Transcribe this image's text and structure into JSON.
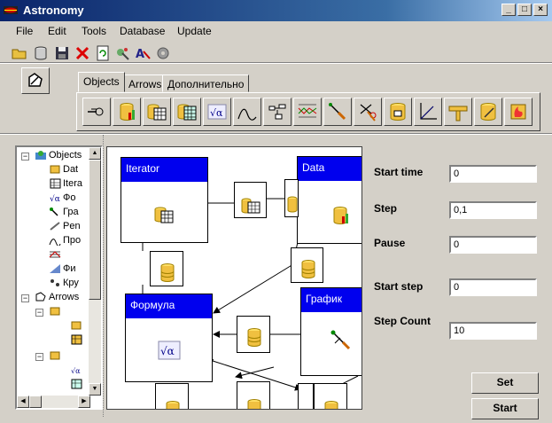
{
  "window": {
    "title": "Astronomy",
    "controls": {
      "minimize": "_",
      "maximize": "□",
      "close": "×"
    }
  },
  "menu": [
    "File",
    "Edit",
    "Tools",
    "Database",
    "Update"
  ],
  "toolbar_icons": [
    "open-folder-icon",
    "database-icon",
    "save-icon",
    "delete-icon",
    "refresh-icon",
    "tools-icon",
    "translate-icon",
    "settings-icon"
  ],
  "tabs": [
    {
      "label": "Objects",
      "active": true
    },
    {
      "label": "Arrows",
      "active": false
    },
    {
      "label": "Дополнительно",
      "active": false
    }
  ],
  "components": [
    "link",
    "data",
    "iterator",
    "table",
    "formula",
    "curve",
    "graph-tool",
    "chart-lines",
    "probe",
    "scissors",
    "data-chart",
    "axes",
    "ruler",
    "data-pencil",
    "fire"
  ],
  "tree": {
    "items": [
      {
        "label": "Objects",
        "level": 0,
        "expander": "−"
      },
      {
        "label": "Dat",
        "level": 1
      },
      {
        "label": "Itera",
        "level": 1
      },
      {
        "label": "Фо",
        "level": 1
      },
      {
        "label": "Гра",
        "level": 1
      },
      {
        "label": "Pen",
        "level": 1
      },
      {
        "label": "Про",
        "level": 1
      },
      {
        "label": "",
        "level": 1
      },
      {
        "label": "Фи",
        "level": 1
      },
      {
        "label": "Кру",
        "level": 1
      },
      {
        "label": "Arrows",
        "level": 0,
        "expander": "−"
      }
    ]
  },
  "canvas": {
    "nodes": [
      {
        "id": "iterator",
        "title": "Iterator"
      },
      {
        "id": "data",
        "title": "Data"
      },
      {
        "id": "formula",
        "title": "Формула"
      },
      {
        "id": "graph",
        "title": "График"
      }
    ]
  },
  "properties": [
    {
      "label": "Start time",
      "value": "0"
    },
    {
      "label": "Step",
      "value": "0,1"
    },
    {
      "label": "Pause",
      "value": "0"
    },
    {
      "label": "Start step",
      "value": "0"
    },
    {
      "label": "Step Count",
      "value": "10"
    }
  ],
  "buttons": {
    "set": "Set",
    "start": "Start"
  },
  "colors": {
    "node_header": "#0000ee",
    "titlebar": "#0a246a",
    "face": "#d4d0c8"
  }
}
